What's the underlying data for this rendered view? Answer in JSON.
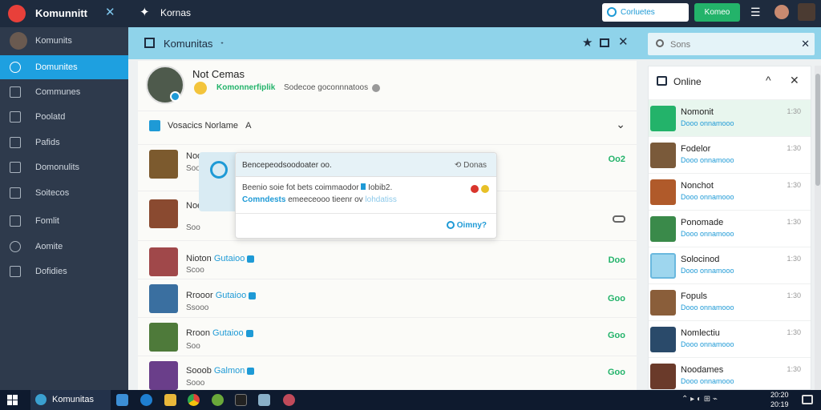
{
  "topbar": {
    "app_title": "Komunnitt",
    "section_title": "Kornas",
    "search_placeholder": "Corluetes",
    "action_button": "Komeo"
  },
  "sidebar": {
    "user_label": "Komunits",
    "items": [
      {
        "label": "Domunites",
        "icon": "chat-icon",
        "active": true
      },
      {
        "label": "Communes",
        "icon": "list-icon"
      },
      {
        "label": "Poolatd",
        "icon": "doc-icon"
      },
      {
        "label": "Pafids",
        "icon": "edit-icon"
      },
      {
        "label": "Domonulits",
        "icon": "grid-icon"
      },
      {
        "label": "Soitecos",
        "icon": "image-icon"
      },
      {
        "label": "Fomlit",
        "icon": "folder-icon"
      },
      {
        "label": "Aomite",
        "icon": "settings-icon"
      },
      {
        "label": "Dofidies",
        "icon": "message-icon"
      }
    ]
  },
  "page_header": {
    "title": "Komunitas",
    "title_suffix": "ᐩ"
  },
  "search": {
    "placeholder": "Sons"
  },
  "profile": {
    "name": "Not Cemas",
    "link": "Komonnerfiplik",
    "subtitle": "Sodecoe goconnnatoos"
  },
  "section": {
    "label": "Vosacics Norlame",
    "label_suffix": "A"
  },
  "posts": [
    {
      "name": "Noo",
      "meta": "Soo",
      "tag": "",
      "status": "Oo2"
    },
    {
      "name": "Noe",
      "meta": "Soo",
      "tag": "",
      "status": ""
    },
    {
      "name": "Nioton",
      "meta": "Scoo",
      "tag": "Gutaioo",
      "status": "Doo"
    },
    {
      "name": "Rrooor",
      "meta": "Ssooo",
      "tag": "Gutaioo",
      "status": "Goo"
    },
    {
      "name": "Rroon",
      "meta": "Soo",
      "tag": "Gutaioo",
      "status": "Goo"
    },
    {
      "name": "Sooob",
      "meta": "Sooo",
      "tag": "Galmon",
      "status": "Goo"
    }
  ],
  "popup": {
    "title": "Bencepeodsoodoater oo.",
    "title_action": "Donas",
    "line1": "Beenio soie fot bets coimmaodor",
    "line1_suffix": "Iobib2.",
    "line2_link": "Comndests",
    "line2_rest": "emeeceooo tieenr ov",
    "line2_link2": "lohdatiss",
    "footer_action": "Oimny?"
  },
  "online_panel": {
    "title": "Online",
    "contacts": [
      {
        "name": "Nomonit",
        "status": "Dooo onnamooo",
        "time": "1:30"
      },
      {
        "name": "Fodelor",
        "status": "Dooo onnamooo",
        "time": "1:30"
      },
      {
        "name": "Nonchot",
        "status": "Dooo onnamooo",
        "time": "1:30"
      },
      {
        "name": "Ponomade",
        "status": "Dooo onnamooo",
        "time": "1:30"
      },
      {
        "name": "Solocinod",
        "status": "Dooo onnamooo",
        "time": "1:30"
      },
      {
        "name": "Fopuls",
        "status": "Dooo onnamooo",
        "time": "1:30"
      },
      {
        "name": "Nomlectiu",
        "status": "Dooo onnamooo",
        "time": "1:30"
      },
      {
        "name": "Noodames",
        "status": "Dooo onnamooo",
        "time": "1:30"
      }
    ]
  },
  "taskbar": {
    "active_app": "Komunitas",
    "clock_time": "20:20",
    "clock_date": "20:19"
  },
  "colors": {
    "accent": "#1ea0e0",
    "header": "#8fd3ea",
    "green": "#23b36a",
    "sidebar": "#2e3a4c",
    "topbar": "#1e2b3e"
  }
}
